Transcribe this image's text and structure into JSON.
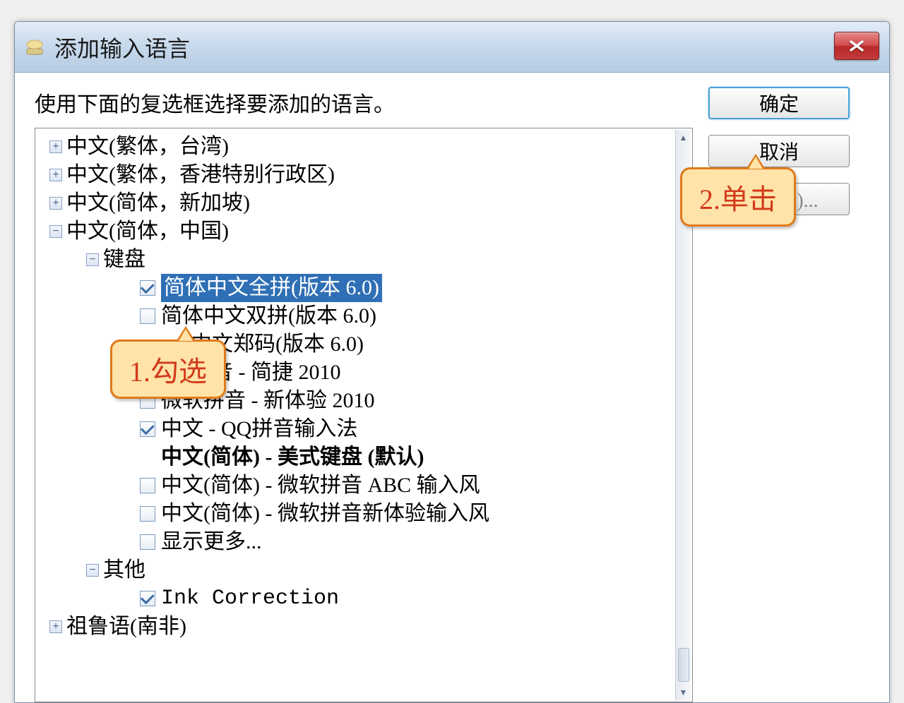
{
  "window": {
    "title": "添加输入语言"
  },
  "instruction": "使用下面的复选框选择要添加的语言。",
  "buttons": {
    "ok": "确定",
    "cancel": "取消",
    "preview": "预览(P)..."
  },
  "callouts": {
    "c1": "1.勾选",
    "c2": "2.单击"
  },
  "tree": {
    "n0": "中文(繁体，台湾)",
    "n1": "中文(繁体，香港特别行政区)",
    "n2": "中文(简体，新加坡)",
    "n3": "中文(简体，中国)",
    "n3_k": "键盘",
    "k0": "简体中文全拼(版本 6.0)",
    "k1": "简体中文双拼(版本 6.0)",
    "k2": "中文郑码(版本 6.0)",
    "k3": "拼音 - 简捷 2010",
    "k4": "微软拼音 - 新体验 2010",
    "k5": "中文 - QQ拼音输入法",
    "k6": "中文(简体) - 美式键盘 (默认)",
    "k7": "中文(简体) - 微软拼音 ABC 输入风",
    "k8": "中文(简体) - 微软拼音新体验输入风",
    "k9": "显示更多...",
    "n3_o": "其他",
    "o0": "Ink Correction",
    "n4": "祖鲁语(南非)"
  }
}
